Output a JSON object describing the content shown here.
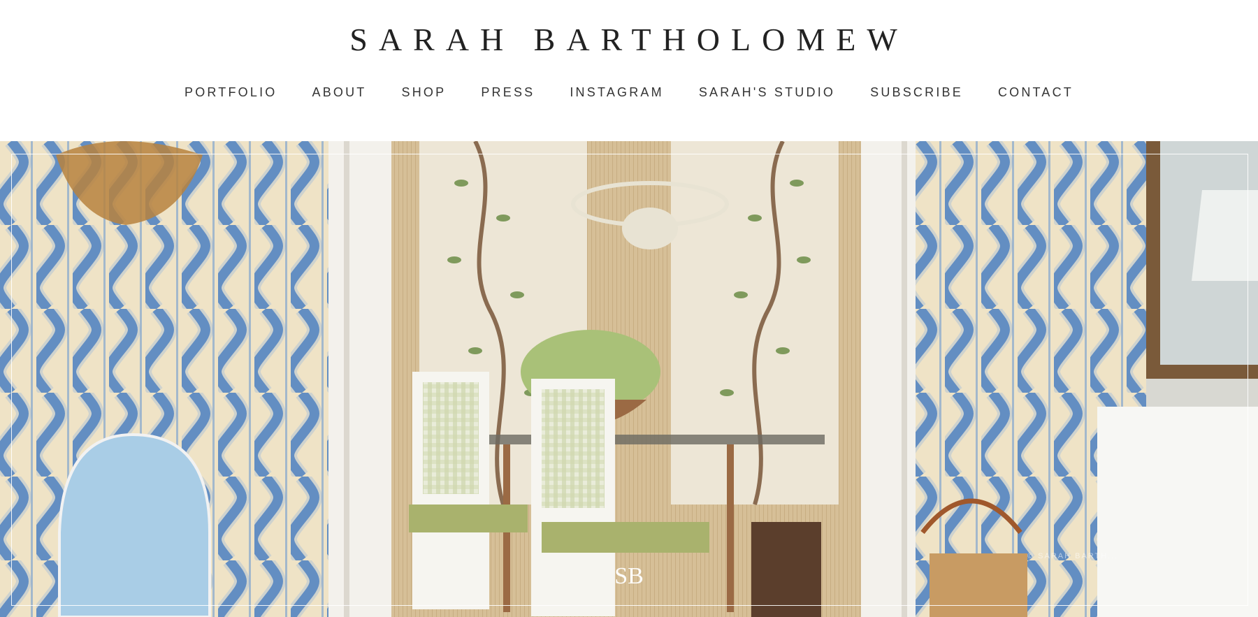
{
  "site": {
    "title": "SARAH BARTHOLOMEW"
  },
  "nav": {
    "items": [
      {
        "label": "PORTFOLIO"
      },
      {
        "label": "ABOUT"
      },
      {
        "label": "SHOP"
      },
      {
        "label": "PRESS"
      },
      {
        "label": "INSTAGRAM"
      },
      {
        "label": "SARAH'S STUDIO"
      },
      {
        "label": "SUBSCRIBE"
      },
      {
        "label": "CONTACT"
      }
    ]
  },
  "hero": {
    "monogram": "SB",
    "credit": "© SARAH BARTH...",
    "colors": {
      "wallpaper_cream": "#efe3c6",
      "ikat_blue": "#3b70b3",
      "panel_tan": "#d8c3a0",
      "leaf_green": "#7f9a5c",
      "chair_seat": "#a9b26d",
      "door_white": "#f3f1ec"
    }
  }
}
